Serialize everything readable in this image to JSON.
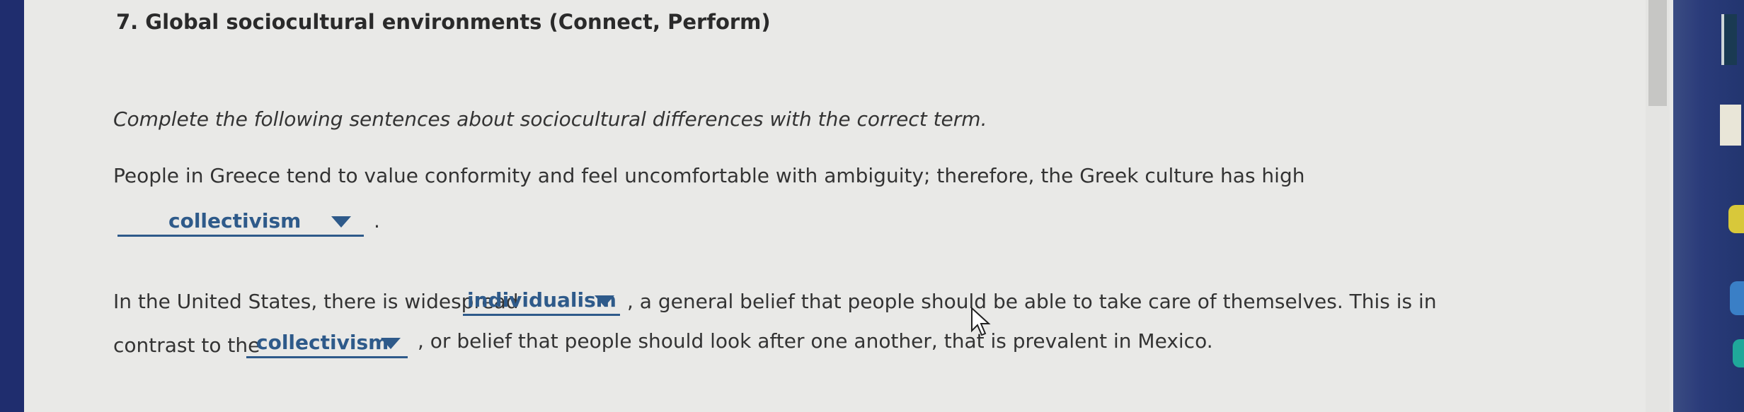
{
  "question": {
    "title": "7. Global sociocultural environments (Connect, Perform)",
    "instructions": "Complete the following sentences about sociocultural differences with the correct term."
  },
  "sentence1": {
    "text": "People in Greece tend to value conformity and feel uncomfortable with ambiguity; therefore, the Greek culture has high",
    "dropdown_value": "collectivism",
    "end": "."
  },
  "sentence2": {
    "prefix": "In the United States, there is widespread",
    "dropdown1_value": "individualism",
    "middle": ", a general belief that people should be able to take care of themselves. This is in",
    "line2_prefix": "contrast to the",
    "dropdown2_value": "collectivism",
    "suffix": ", or belief that people should look after one another, that is prevalent in Mexico."
  },
  "colors": {
    "dropdown_text": "#2e5a8a",
    "body_text": "#333333",
    "background": "#e9e9e7"
  }
}
